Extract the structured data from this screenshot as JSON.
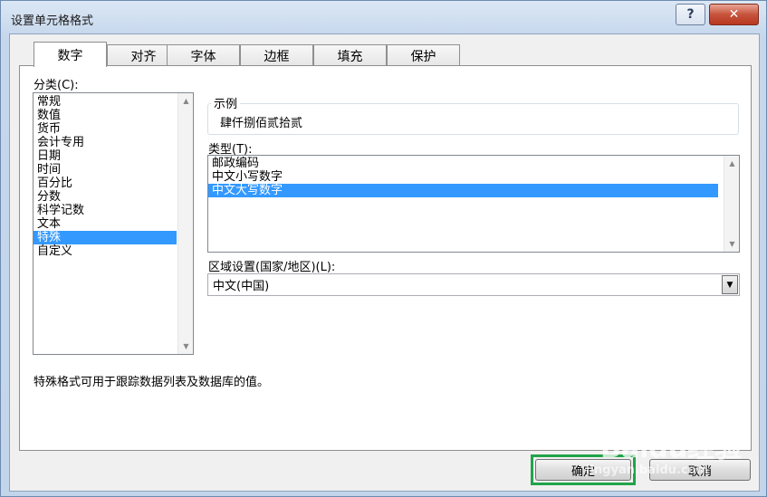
{
  "window": {
    "title": "设置单元格格式",
    "help_label": "?",
    "close_label": "✕"
  },
  "tabs": [
    {
      "label": "数字",
      "active": true
    },
    {
      "label": "对齐"
    },
    {
      "label": "字体"
    },
    {
      "label": "边框"
    },
    {
      "label": "填充"
    },
    {
      "label": "保护"
    }
  ],
  "category": {
    "label": "分类(C):",
    "items": [
      "常规",
      "数值",
      "货币",
      "会计专用",
      "日期",
      "时间",
      "百分比",
      "分数",
      "科学记数",
      "文本",
      "特殊",
      "自定义"
    ],
    "selected": "特殊"
  },
  "sample": {
    "label": "示例",
    "value": "肆仟捌佰贰拾贰"
  },
  "type": {
    "label": "类型(T):",
    "items": [
      "邮政编码",
      "中文小写数字",
      "中文大写数字"
    ],
    "selected": "中文大写数字"
  },
  "locale": {
    "label": "区域设置(国家/地区)(L):",
    "value": "中文(中国)"
  },
  "description": "特殊格式可用于跟踪数据列表及数据库的值。",
  "buttons": {
    "ok": "确定",
    "cancel": "取消"
  },
  "watermark": {
    "brand": "Baidu",
    "brand_suffix": "经验",
    "url": "jingyan.baidu.com"
  },
  "colors": {
    "selection": "#3399ff",
    "highlight_border": "#22a34a"
  }
}
